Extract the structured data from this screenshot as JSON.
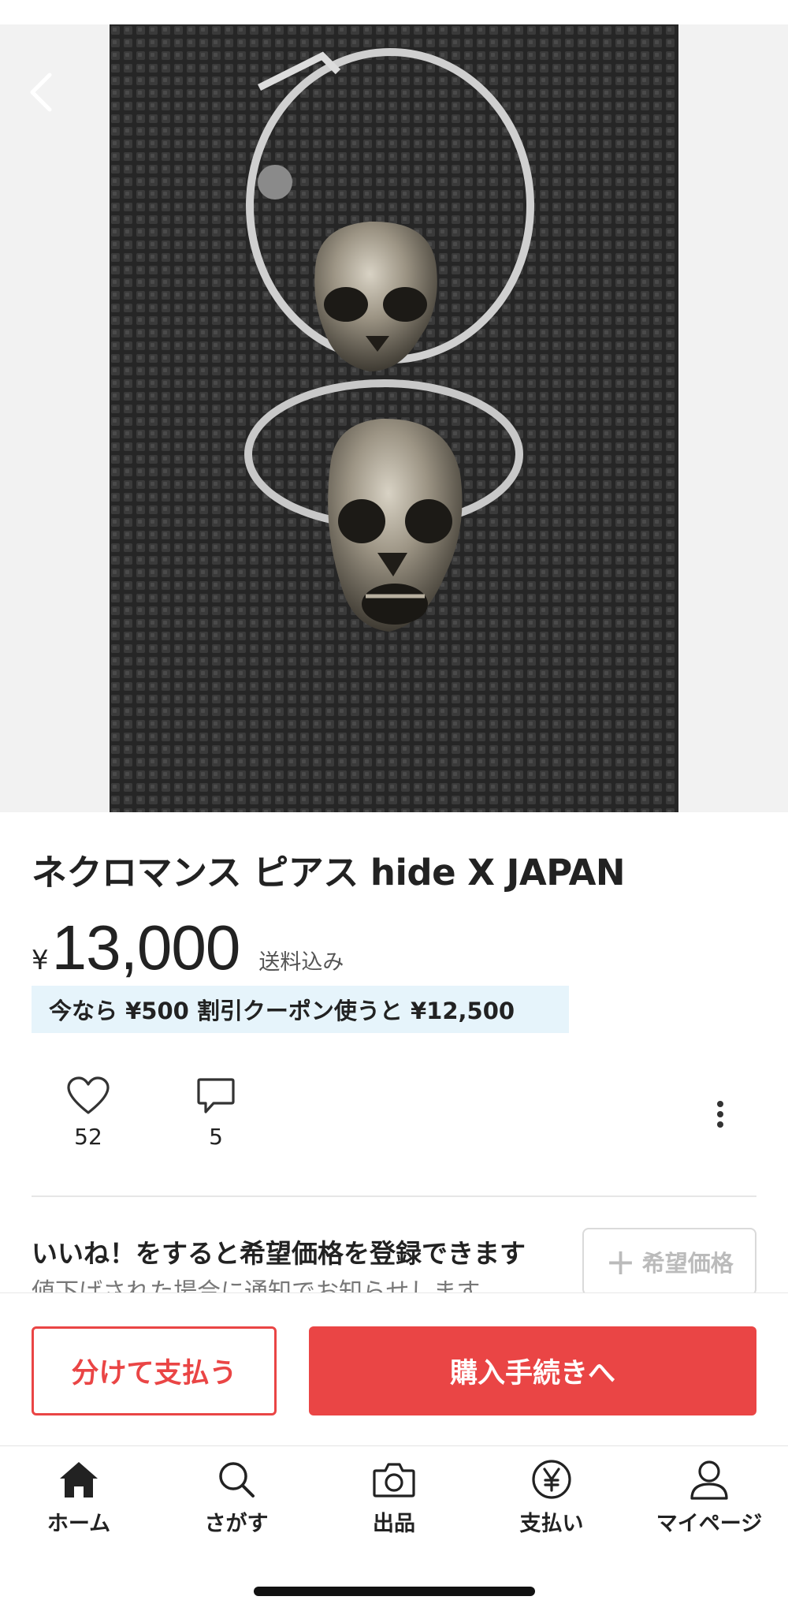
{
  "product": {
    "title": "ネクロマンス ピアス hide X JAPAN",
    "currency_symbol": "¥",
    "price": "13,000",
    "shipping": "送料込み",
    "coupon_text": "今なら ¥500 割引クーポン使うと ¥12,500"
  },
  "actions": {
    "likes_count": "52",
    "comments_count": "5"
  },
  "wish_price": {
    "title": "いいね！をすると希望価格を登録できます",
    "subtitle": "値下げされた場合に通知でお知らせします",
    "button_label": "希望価格"
  },
  "purchase": {
    "split_label": "分けて支払う",
    "buy_label": "購入手続きへ"
  },
  "nav": [
    {
      "label": "ホーム",
      "icon": "home-icon"
    },
    {
      "label": "さがす",
      "icon": "search-icon"
    },
    {
      "label": "出品",
      "icon": "camera-icon"
    },
    {
      "label": "支払い",
      "icon": "yen-icon"
    },
    {
      "label": "マイページ",
      "icon": "person-icon"
    }
  ],
  "colors": {
    "accent": "#ea4545",
    "coupon_bg": "#e6f4fb"
  }
}
